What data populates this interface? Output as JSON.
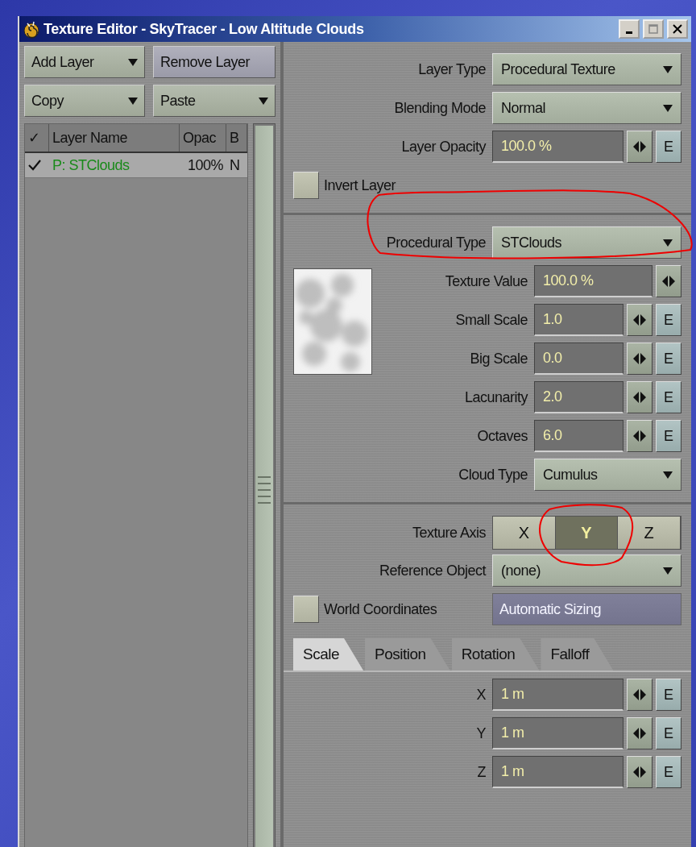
{
  "window": {
    "title": "Texture Editor - SkyTracer - Low Altitude Clouds"
  },
  "layer_buttons": [
    {
      "label": "Add Layer",
      "kind": "dropdown"
    },
    {
      "label": "Remove Layer",
      "kind": "button"
    },
    {
      "label": "Copy",
      "kind": "dropdown"
    },
    {
      "label": "Paste",
      "kind": "dropdown"
    }
  ],
  "layer_table": {
    "columns": [
      "✓",
      "Layer Name",
      "Opac",
      "B"
    ],
    "rows": [
      {
        "checked": true,
        "selected": true,
        "name": "P: STClouds",
        "opacity": "100%",
        "blending": "N"
      }
    ]
  },
  "layer_settings": [
    {
      "label": "Layer Type",
      "kind": "dropdown",
      "value": "Procedural Texture"
    },
    {
      "label": "Blending Mode",
      "kind": "dropdown",
      "value": "Normal"
    },
    {
      "label": "Layer Opacity",
      "kind": "envelope",
      "value": "100.0 %",
      "envelope": "E"
    }
  ],
  "invert_layer": {
    "label": "Invert Layer",
    "checked": false
  },
  "procedural": {
    "type": {
      "label": "Procedural Type",
      "kind": "dropdown",
      "value": "STClouds"
    },
    "settings": [
      {
        "label": "Texture Value",
        "kind": "value",
        "value": "100.0 %"
      },
      {
        "label": "Small Scale",
        "kind": "envelope",
        "value": "1.0",
        "envelope": "E"
      },
      {
        "label": "Big Scale",
        "kind": "envelope",
        "value": "0.0",
        "envelope": "E"
      },
      {
        "label": "Lacunarity",
        "kind": "envelope",
        "value": "2.0",
        "envelope": "E"
      },
      {
        "label": "Octaves",
        "kind": "envelope",
        "value": "6.0",
        "envelope": "E"
      },
      {
        "label": "Cloud Type",
        "kind": "dropdown",
        "value": "Cumulus"
      }
    ]
  },
  "texture_axis": {
    "label": "Texture Axis",
    "options": [
      {
        "label": "X",
        "selected": false
      },
      {
        "label": "Y",
        "selected": true
      },
      {
        "label": "Z",
        "selected": false
      }
    ]
  },
  "reference_object": {
    "label": "Reference Object",
    "kind": "dropdown",
    "value": "(none)"
  },
  "world_coordinates": {
    "label": "World Coordinates",
    "checked": false
  },
  "automatic_sizing": {
    "label": "Automatic Sizing",
    "disabled": true
  },
  "tabs": [
    {
      "label": "Scale",
      "selected": true
    },
    {
      "label": "Position",
      "selected": false
    },
    {
      "label": "Rotation",
      "selected": false
    },
    {
      "label": "Falloff",
      "selected": false
    }
  ],
  "scale": [
    {
      "label": "X",
      "kind": "envelope",
      "value": "1 m",
      "envelope": "E"
    },
    {
      "label": "Y",
      "kind": "envelope",
      "value": "1 m",
      "envelope": "E"
    },
    {
      "label": "Z",
      "kind": "envelope",
      "value": "1 m",
      "envelope": "E"
    }
  ]
}
